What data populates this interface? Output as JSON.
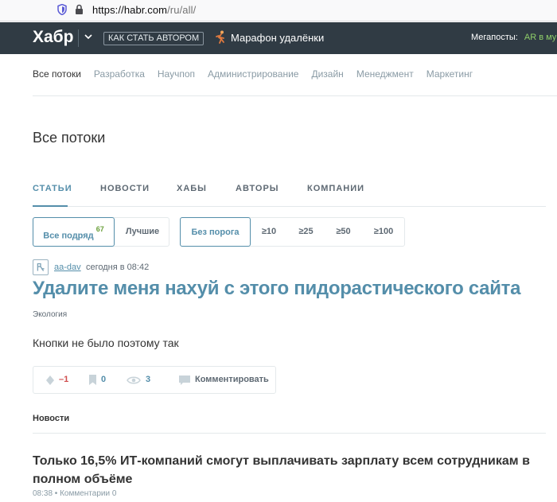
{
  "browser": {
    "url_host": "https://habr.com",
    "url_path": "/ru/all/"
  },
  "header": {
    "logo": "Хабр",
    "author_button": "КАК СТАТЬ АВТОРОМ",
    "marathon": "Марафон удалёнки",
    "megaposts_label": "Мегапосты:",
    "megaposts_value": "AR в му"
  },
  "nav": {
    "items": [
      "Все потоки",
      "Разработка",
      "Научпоп",
      "Администрирование",
      "Дизайн",
      "Менеджмент",
      "Маркетинг"
    ]
  },
  "page_title": "Все потоки",
  "tabs": [
    "СТАТЬИ",
    "НОВОСТИ",
    "ХАБЫ",
    "АВТОРЫ",
    "КОМПАНИИ"
  ],
  "filters": {
    "sort": [
      "Все подряд",
      "Лучшие"
    ],
    "sort_count": "67",
    "threshold": [
      "Без порога",
      "≥10",
      "≥25",
      "≥50",
      "≥100"
    ]
  },
  "post": {
    "author": "aa-dav",
    "time": "сегодня в 08:42",
    "title": "Удалите меня нахуй с этого пидорастического сайта",
    "hub": "Экология",
    "body": "Кнопки не было поэтому так",
    "rating": "–1",
    "bookmarks": "0",
    "views": "3",
    "comment_label": "Комментировать"
  },
  "news": {
    "label": "Новости",
    "title": "Только 16,5% ИТ-компаний смогут выплачивать зарплату всем сотрудникам в полном объёме",
    "meta": "08:38 • Комментарии 0"
  },
  "colors": {
    "header_bg": "#303b44",
    "accent": "#548eaa",
    "negative": "#d04e4e"
  }
}
